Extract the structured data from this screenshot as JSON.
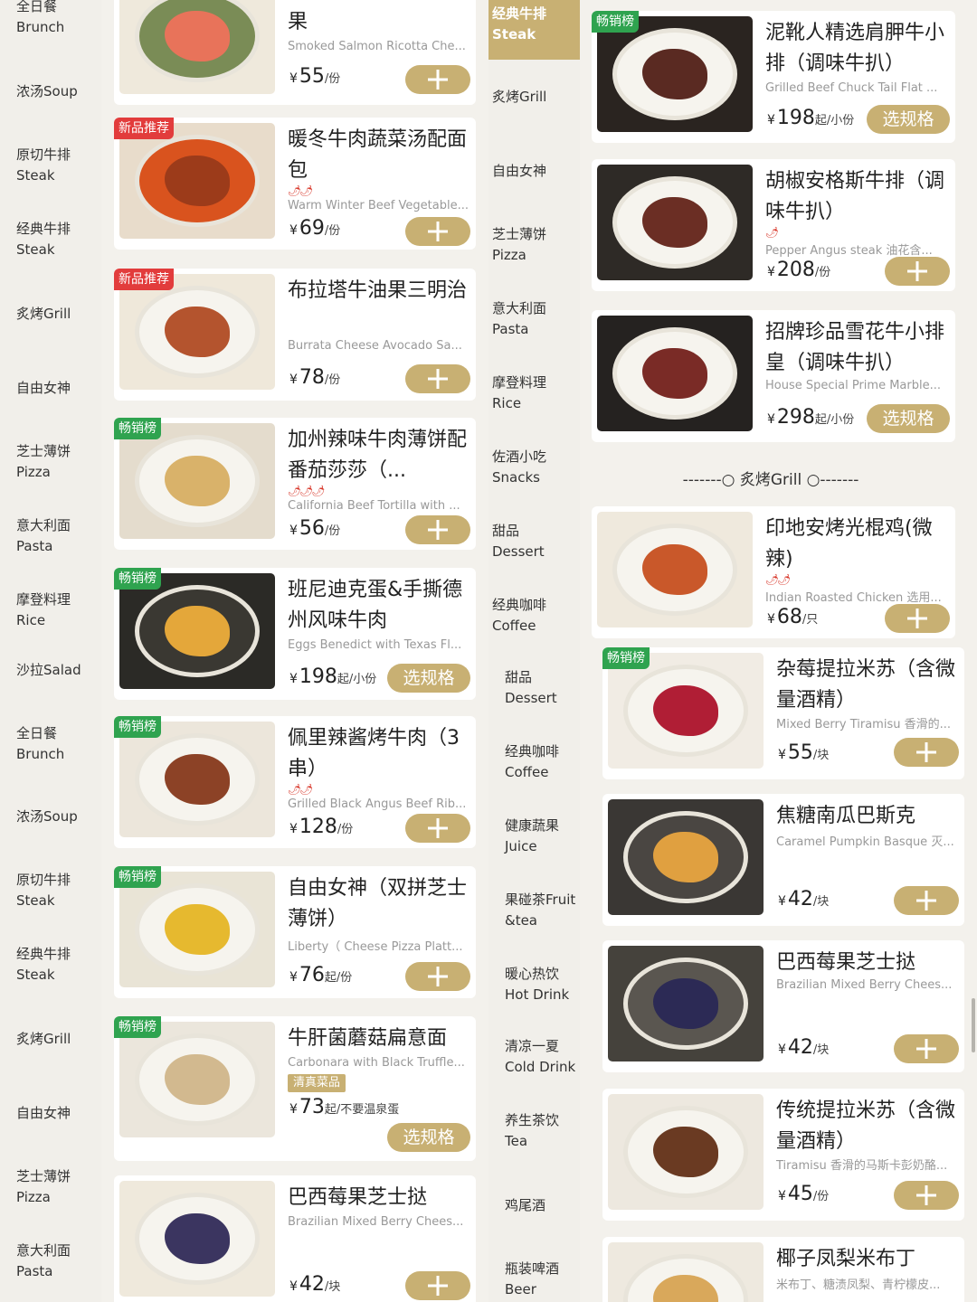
{
  "left_nav": [
    {
      "label": "全日餐\nBrunch"
    },
    {
      "label": "浓汤Soup"
    },
    {
      "label": "原切牛排\nSteak"
    },
    {
      "label": "经典牛排\nSteak"
    },
    {
      "label": "炙烤Grill"
    },
    {
      "label": "自由女神"
    },
    {
      "label": "芝士薄饼\nPizza"
    },
    {
      "label": "意大利面\nPasta"
    },
    {
      "label": "摩登料理\nRice"
    },
    {
      "label": "沙拉Salad"
    },
    {
      "label": "全日餐\nBrunch"
    },
    {
      "label": "浓汤Soup"
    },
    {
      "label": "原切牛排\nSteak"
    },
    {
      "label": "经典牛排\nSteak"
    },
    {
      "label": "炙烤Grill"
    },
    {
      "label": "自由女神"
    },
    {
      "label": "芝士薄饼\nPizza"
    },
    {
      "label": "意大利面\nPasta"
    }
  ],
  "mid_nav": [
    {
      "label": "经典牛排\nSteak"
    },
    {
      "label": "炙烤Grill"
    },
    {
      "label": "自由女神"
    },
    {
      "label": "芝士薄饼\nPizza"
    },
    {
      "label": "意大利面\nPasta"
    },
    {
      "label": "摩登料理\nRice"
    },
    {
      "label": "佐酒小吃\nSnacks"
    },
    {
      "label": "甜品\nDessert"
    },
    {
      "label": "经典咖啡\nCoffee"
    },
    {
      "label": "甜品\nDessert"
    },
    {
      "label": "经典咖啡\nCoffee"
    },
    {
      "label": "健康蔬果\nJuice"
    },
    {
      "label": "果碰茶Fruit\n&tea"
    },
    {
      "label": "暖心热饮\nHot Drink"
    },
    {
      "label": "清凉一夏\nCold Drink"
    },
    {
      "label": "养生茶饮\nTea"
    },
    {
      "label": "鸡尾酒"
    },
    {
      "label": "瓶装啤酒\nBeer"
    }
  ],
  "left_items": [
    {
      "badge": "",
      "title": "果",
      "sub": "Smoked Salmon Ricotta Che...",
      "price": "55",
      "unit": "/份",
      "action": "add"
    },
    {
      "badge": "新品推荐",
      "title": "暖冬牛肉蔬菜汤配面包",
      "spice": "🌶🌶",
      "sub": "Warm Winter Beef Vegetable...",
      "price": "69",
      "unit": "/份",
      "action": "add"
    },
    {
      "badge": "新品推荐",
      "title": "布拉塔牛油果三明治",
      "sub": "Burrata Cheese Avocado Sa...",
      "price": "78",
      "unit": "/份",
      "action": "add"
    },
    {
      "badge": "畅销榜",
      "title": "加州辣味牛肉薄饼配番茄莎莎（...",
      "spice": "🌶🌶🌶",
      "sub": "California Beef Tortilla with ...",
      "price": "56",
      "unit": "/份",
      "action": "add"
    },
    {
      "badge": "畅销榜",
      "title": "班尼迪克蛋&手撕德州风味牛肉",
      "sub": "Eggs Benedict with Texas Fl...",
      "price": "198",
      "unit": "起/小份",
      "action": "spec",
      "action_label": "选规格"
    },
    {
      "badge": "畅销榜",
      "title": "佩里辣酱烤牛肉（3串）",
      "spice": "🌶🌶",
      "sub": "Grilled Black Angus Beef Rib...",
      "price": "128",
      "unit": "/份",
      "action": "add"
    },
    {
      "badge": "畅销榜",
      "title": "自由女神（双拼芝士薄饼）",
      "sub": "Liberty（ Cheese Pizza Platt...",
      "price": "76",
      "unit": "起/份",
      "action": "add"
    },
    {
      "badge": "畅销榜",
      "title": "牛肝菌蘑菇扁意面",
      "sub": "Carbonara with Black Truffle...",
      "tag": "清真菜品",
      "price": "73",
      "unit": "起/不要温泉蛋",
      "action": "spec",
      "action_label": "选规格"
    },
    {
      "badge": "",
      "title": "巴西莓果芝士挞",
      "sub": "Brazilian Mixed Berry Chees...",
      "price": "42",
      "unit": "/块",
      "action": "add"
    }
  ],
  "right_items": [
    {
      "badge": "畅销榜",
      "title": "泥靴人精选肩胛牛小排（调味牛扒）",
      "sub": "Grilled Beef Chuck Tail Flat ...",
      "price": "198",
      "unit": "起/小份",
      "action": "spec",
      "action_label": "选规格"
    },
    {
      "badge": "",
      "title": "胡椒安格斯牛排（调味牛扒）",
      "spice": "🌶",
      "sub": "Pepper Angus steak 油花含...",
      "price": "208",
      "unit": "/份",
      "action": "add"
    },
    {
      "badge": "",
      "title": "招牌珍品雪花牛小排皇（调味牛扒）",
      "sub": "House Special Prime Marble...",
      "price": "298",
      "unit": "起/小份",
      "action": "spec",
      "action_label": "选规格"
    },
    {
      "badge": "",
      "title": "印地安烤光棍鸡(微辣)",
      "spice": "🌶🌶",
      "sub": "Indian Roasted Chicken 选用...",
      "price": "68",
      "unit": "/只",
      "action": "add"
    }
  ],
  "divider_label": "-------○ 炙烤Grill ○-------",
  "right_items_2": [
    {
      "badge": "畅销榜",
      "title": "杂莓提拉米苏（含微量酒精）",
      "sub": "Mixed Berry Tiramisu 香滑的...",
      "price": "55",
      "unit": "/块",
      "action": "add"
    },
    {
      "badge": "",
      "title": "焦糖南瓜巴斯克",
      "sub": "Caramel Pumpkin Basque 灭...",
      "price": "42",
      "unit": "/块",
      "action": "add"
    },
    {
      "badge": "",
      "title": "巴西莓果芝士挞",
      "sub": "Brazilian Mixed Berry Chees...",
      "price": "42",
      "unit": "/块",
      "action": "add"
    },
    {
      "badge": "",
      "title": "传统提拉米苏（含微量酒精）",
      "sub": "Tiramisu 香滑的马斯卡彭奶酪...",
      "price": "45",
      "unit": "/份",
      "action": "add"
    },
    {
      "badge": "",
      "title": "椰子凤梨米布丁",
      "sub": "米布丁、糖渍凤梨、青柠檬皮...",
      "action": "none"
    }
  ],
  "currency": "¥",
  "colors": {
    "accent": "#c8b073",
    "new_badge": "#e23c3c",
    "hot_badge": "#2fa34f",
    "spice": "#d8372a"
  }
}
